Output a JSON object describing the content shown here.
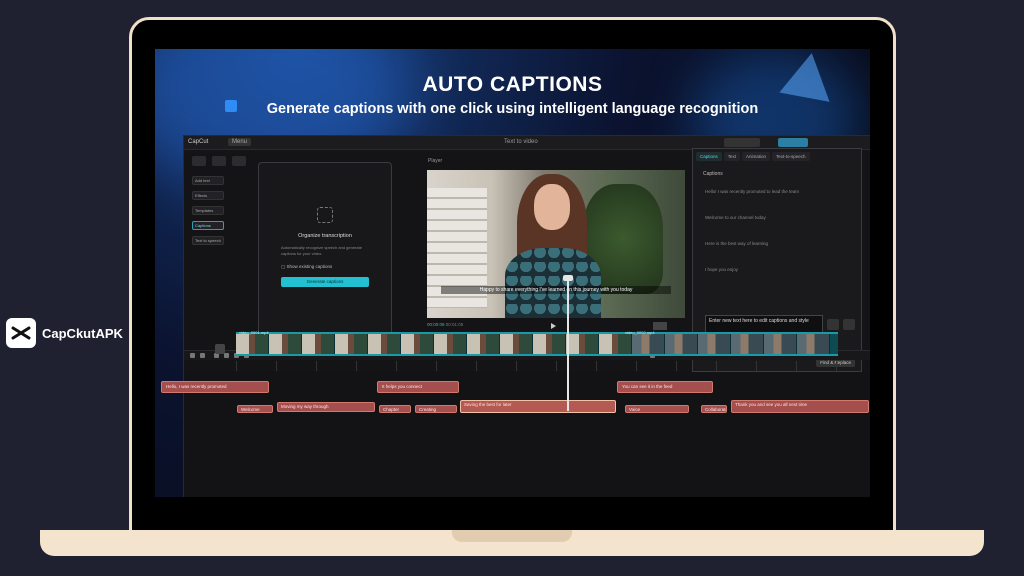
{
  "brand": {
    "name": "CapCkutAPK",
    "logo_icon": "capcut-logo-icon"
  },
  "hero": {
    "title": "AUTO CAPTIONS",
    "subtitle": "Generate captions with one click using intelligent language recognition"
  },
  "editor": {
    "app_title": "CapCut",
    "menu": "Menu",
    "project_title": "Text to video",
    "sidebar_items": [
      "Add text",
      "Effects",
      "Templates",
      "Captions",
      "Text to speech"
    ],
    "captions_panel": {
      "title": "Organize transcription",
      "description": "Automatically recognize speech and generate captions for your video.",
      "checkbox": "Show existing captions",
      "button": "Generate captions"
    },
    "player": {
      "label": "Player",
      "caption_text": "Happy to share everything I've learned on this journey with you today",
      "time_current": "00:00:08",
      "time_total": "00:01:05"
    },
    "properties": {
      "tabs": [
        "Captions",
        "Text",
        "Animation",
        "Text-to-speech"
      ],
      "active_tab": "Captions",
      "section": "Captions",
      "rows": [
        "Hello! I was recently promoted to lead the team",
        "Welcome to our channel today",
        "Here is the best way of learning",
        "I hope you enjoy"
      ],
      "edit_text": "Enter new text here to edit captions and style",
      "footer_button": "Find & Replace"
    },
    "timeline": {
      "caption_row_1": [
        "Hello, I was recently promoted",
        "It helps you connect",
        "You can see it in the feed"
      ],
      "caption_row_2": [
        "Welcome",
        "Moving my way through",
        "Chapter",
        "Creating",
        "Saving the best for later",
        "Voice",
        "Collaborate",
        "Thank you and see you all next time"
      ],
      "video_label_1": "video_0001.mp4",
      "video_label_2": "video_0002.mp4"
    }
  }
}
